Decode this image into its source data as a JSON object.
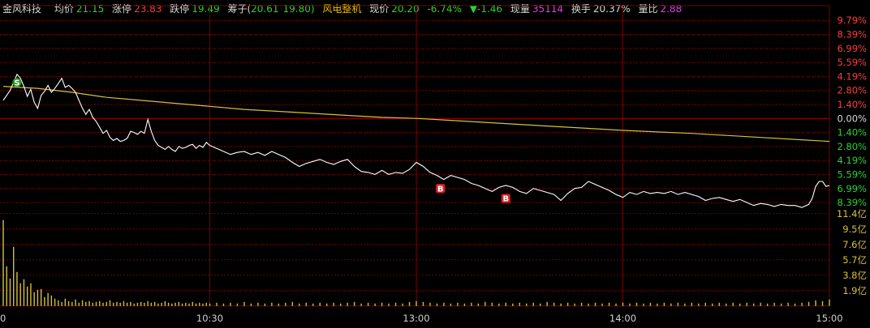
{
  "header": {
    "stock_name": "金风科技",
    "avg_label": "均价",
    "avg_value": "21.15",
    "limit_up_label": "涨停",
    "limit_up_value": "23.83",
    "limit_down_label": "跌停",
    "limit_down_value": "19.49",
    "chips_label": "筹子(",
    "chips_value_1": "20.61",
    "chips_value_2": "19.80)",
    "sector": "风电整机",
    "price_label": "现价",
    "price_value": "20.20",
    "change_pct": "-6.74%",
    "change_value": "▼-1.46",
    "volume_label": "现量",
    "volume_value": "35114",
    "turnover_label": "换手",
    "turnover_value": "20.37%",
    "vol_ratio_label": "量比",
    "vol_ratio_value": "2.88"
  },
  "colors": {
    "background": "#000000",
    "grid": "#7a0000",
    "price_line": "#ffffff",
    "avg_line": "#d4c23a",
    "volume_bars": "#d4c23a",
    "up": "#ff3b3b",
    "down": "#2ad52a",
    "neutral": "#d8d8d8",
    "marker_buy": "#e02020",
    "marker_sell": "#1aa01a"
  },
  "chart_data": {
    "type": "line",
    "y_right_labels": [
      {
        "text": "9.79%",
        "tone": "up"
      },
      {
        "text": "8.39%",
        "tone": "up"
      },
      {
        "text": "6.99%",
        "tone": "up"
      },
      {
        "text": "5.59%",
        "tone": "up"
      },
      {
        "text": "4.19%",
        "tone": "up"
      },
      {
        "text": "2.80%",
        "tone": "up"
      },
      {
        "text": "1.40%",
        "tone": "up"
      },
      {
        "text": "0.00%",
        "tone": "neutral"
      },
      {
        "text": "1.40%",
        "tone": "down"
      },
      {
        "text": "2.80%",
        "tone": "down"
      },
      {
        "text": "4.19%",
        "tone": "down"
      },
      {
        "text": "5.59%",
        "tone": "down"
      },
      {
        "text": "6.99%",
        "tone": "down"
      },
      {
        "text": "8.39%",
        "tone": "down"
      }
    ],
    "y_pct_ticks": [
      9.79,
      8.39,
      6.99,
      5.59,
      4.19,
      2.8,
      1.4,
      0.0,
      -1.4,
      -2.8,
      -4.19,
      -5.59,
      -6.99,
      -8.39
    ],
    "volume_labels": [
      "11.4亿",
      "9.5亿",
      "7.6亿",
      "5.7亿",
      "3.8亿",
      "1.9亿"
    ],
    "volume_ticks": [
      11.4,
      9.5,
      7.6,
      5.7,
      3.8,
      1.9
    ],
    "x_labels": [
      {
        "text": "0",
        "minute": 0
      },
      {
        "text": "10:30",
        "minute": 60
      },
      {
        "text": "13:00",
        "minute": 120
      },
      {
        "text": "14:00",
        "minute": 180
      },
      {
        "text": "15:00",
        "minute": 240
      }
    ],
    "price_pct": [
      [
        0,
        1.8
      ],
      [
        2,
        2.8
      ],
      [
        4,
        4.4
      ],
      [
        5,
        4.0
      ],
      [
        6,
        3.2
      ],
      [
        7,
        2.2
      ],
      [
        8,
        2.9
      ],
      [
        9,
        1.6
      ],
      [
        10,
        1.0
      ],
      [
        11,
        2.3
      ],
      [
        12,
        2.7
      ],
      [
        13,
        3.3
      ],
      [
        14,
        2.6
      ],
      [
        15,
        3.0
      ],
      [
        16,
        3.5
      ],
      [
        17,
        4.0
      ],
      [
        18,
        3.1
      ],
      [
        19,
        3.3
      ],
      [
        20,
        3.0
      ],
      [
        21,
        2.6
      ],
      [
        22,
        1.8
      ],
      [
        23,
        1.0
      ],
      [
        24,
        0.4
      ],
      [
        25,
        0.9
      ],
      [
        26,
        0.1
      ],
      [
        27,
        -0.3
      ],
      [
        28,
        -0.9
      ],
      [
        29,
        -1.5
      ],
      [
        30,
        -1.2
      ],
      [
        31,
        -1.9
      ],
      [
        32,
        -2.2
      ],
      [
        33,
        -2.0
      ],
      [
        34,
        -2.3
      ],
      [
        35,
        -2.2
      ],
      [
        36,
        -2.0
      ],
      [
        37,
        -1.3
      ],
      [
        38,
        -1.4
      ],
      [
        39,
        -1.6
      ],
      [
        40,
        -1.3
      ],
      [
        41,
        -1.5
      ],
      [
        42,
        -0.1
      ],
      [
        43,
        -1.3
      ],
      [
        44,
        -2.2
      ],
      [
        45,
        -2.7
      ],
      [
        46,
        -2.9
      ],
      [
        47,
        -3.1
      ],
      [
        48,
        -2.8
      ],
      [
        49,
        -3.1
      ],
      [
        50,
        -3.3
      ],
      [
        51,
        -2.8
      ],
      [
        52,
        -3.0
      ],
      [
        53,
        -2.9
      ],
      [
        54,
        -2.7
      ],
      [
        55,
        -2.6
      ],
      [
        56,
        -3.0
      ],
      [
        57,
        -2.7
      ],
      [
        58,
        -2.9
      ],
      [
        59,
        -2.4
      ],
      [
        60,
        -2.7
      ],
      [
        62,
        -3.0
      ],
      [
        64,
        -3.3
      ],
      [
        66,
        -3.6
      ],
      [
        68,
        -3.4
      ],
      [
        70,
        -3.3
      ],
      [
        72,
        -3.6
      ],
      [
        74,
        -3.4
      ],
      [
        76,
        -3.7
      ],
      [
        78,
        -3.3
      ],
      [
        80,
        -3.6
      ],
      [
        82,
        -3.9
      ],
      [
        84,
        -4.4
      ],
      [
        86,
        -4.8
      ],
      [
        88,
        -4.5
      ],
      [
        90,
        -4.3
      ],
      [
        92,
        -4.1
      ],
      [
        94,
        -4.4
      ],
      [
        96,
        -4.6
      ],
      [
        98,
        -4.3
      ],
      [
        100,
        -4.1
      ],
      [
        102,
        -4.8
      ],
      [
        104,
        -5.3
      ],
      [
        106,
        -5.4
      ],
      [
        108,
        -5.6
      ],
      [
        110,
        -5.2
      ],
      [
        112,
        -5.6
      ],
      [
        114,
        -5.4
      ],
      [
        116,
        -5.5
      ],
      [
        118,
        -5.1
      ],
      [
        120,
        -4.4
      ],
      [
        122,
        -4.8
      ],
      [
        124,
        -5.4
      ],
      [
        126,
        -5.7
      ],
      [
        128,
        -6.1
      ],
      [
        130,
        -5.7
      ],
      [
        132,
        -5.9
      ],
      [
        134,
        -6.1
      ],
      [
        136,
        -6.5
      ],
      [
        138,
        -6.7
      ],
      [
        140,
        -7.0
      ],
      [
        142,
        -7.3
      ],
      [
        144,
        -6.9
      ],
      [
        146,
        -6.7
      ],
      [
        148,
        -6.9
      ],
      [
        150,
        -7.3
      ],
      [
        152,
        -7.5
      ],
      [
        154,
        -7.0
      ],
      [
        156,
        -7.2
      ],
      [
        158,
        -7.4
      ],
      [
        160,
        -7.6
      ],
      [
        162,
        -8.2
      ],
      [
        164,
        -7.5
      ],
      [
        166,
        -7.0
      ],
      [
        168,
        -6.9
      ],
      [
        170,
        -6.3
      ],
      [
        172,
        -6.6
      ],
      [
        174,
        -6.9
      ],
      [
        176,
        -7.2
      ],
      [
        178,
        -7.6
      ],
      [
        180,
        -7.9
      ],
      [
        182,
        -7.4
      ],
      [
        184,
        -7.6
      ],
      [
        186,
        -7.3
      ],
      [
        188,
        -7.5
      ],
      [
        190,
        -7.4
      ],
      [
        192,
        -7.5
      ],
      [
        194,
        -7.3
      ],
      [
        196,
        -7.6
      ],
      [
        198,
        -7.4
      ],
      [
        200,
        -7.6
      ],
      [
        202,
        -7.8
      ],
      [
        204,
        -8.2
      ],
      [
        206,
        -8.0
      ],
      [
        208,
        -7.9
      ],
      [
        210,
        -8.1
      ],
      [
        212,
        -8.3
      ],
      [
        214,
        -8.1
      ],
      [
        216,
        -8.4
      ],
      [
        218,
        -8.7
      ],
      [
        220,
        -8.5
      ],
      [
        222,
        -8.6
      ],
      [
        224,
        -8.8
      ],
      [
        226,
        -8.6
      ],
      [
        228,
        -8.7
      ],
      [
        230,
        -8.7
      ],
      [
        232,
        -8.9
      ],
      [
        234,
        -8.6
      ],
      [
        235,
        -8.0
      ],
      [
        236,
        -6.8
      ],
      [
        237,
        -6.3
      ],
      [
        238,
        -6.3
      ],
      [
        239,
        -6.8
      ],
      [
        240,
        -6.7
      ]
    ],
    "avg_pct": [
      [
        0,
        3.2
      ],
      [
        10,
        3.0
      ],
      [
        20,
        2.6
      ],
      [
        30,
        2.1
      ],
      [
        40,
        1.8
      ],
      [
        50,
        1.5
      ],
      [
        60,
        1.2
      ],
      [
        70,
        0.9
      ],
      [
        80,
        0.7
      ],
      [
        90,
        0.5
      ],
      [
        100,
        0.3
      ],
      [
        110,
        0.1
      ],
      [
        120,
        0.0
      ],
      [
        130,
        -0.2
      ],
      [
        140,
        -0.4
      ],
      [
        150,
        -0.6
      ],
      [
        160,
        -0.8
      ],
      [
        170,
        -1.0
      ],
      [
        180,
        -1.2
      ],
      [
        190,
        -1.35
      ],
      [
        200,
        -1.5
      ],
      [
        210,
        -1.7
      ],
      [
        220,
        -1.9
      ],
      [
        230,
        -2.1
      ],
      [
        240,
        -2.3
      ]
    ],
    "volume_yi": [
      [
        0,
        10.6
      ],
      [
        1,
        4.9
      ],
      [
        2,
        3.4
      ],
      [
        3,
        7.3
      ],
      [
        4,
        4.2
      ],
      [
        5,
        2.8
      ],
      [
        6,
        3.3
      ],
      [
        7,
        2.4
      ],
      [
        8,
        2.8
      ],
      [
        9,
        1.7
      ],
      [
        10,
        2.0
      ],
      [
        11,
        2.1
      ],
      [
        12,
        1.1
      ],
      [
        13,
        1.6
      ],
      [
        14,
        1.3
      ],
      [
        15,
        0.9
      ],
      [
        16,
        0.7
      ],
      [
        17,
        0.5
      ],
      [
        18,
        0.9
      ],
      [
        19,
        0.6
      ],
      [
        20,
        0.5
      ],
      [
        21,
        0.8
      ],
      [
        22,
        0.4
      ],
      [
        23,
        0.7
      ],
      [
        24,
        0.5
      ],
      [
        25,
        0.6
      ],
      [
        26,
        0.4
      ],
      [
        27,
        0.5
      ],
      [
        28,
        0.6
      ],
      [
        29,
        0.4
      ],
      [
        30,
        0.5
      ],
      [
        31,
        0.7
      ],
      [
        32,
        0.4
      ],
      [
        33,
        0.5
      ],
      [
        34,
        0.4
      ],
      [
        35,
        0.6
      ],
      [
        36,
        0.4
      ],
      [
        37,
        0.5
      ],
      [
        38,
        0.3
      ],
      [
        39,
        0.4
      ],
      [
        40,
        0.5
      ],
      [
        41,
        0.4
      ],
      [
        42,
        0.6
      ],
      [
        43,
        0.4
      ],
      [
        44,
        0.5
      ],
      [
        45,
        0.3
      ],
      [
        46,
        0.4
      ],
      [
        47,
        0.6
      ],
      [
        48,
        0.4
      ],
      [
        49,
        0.3
      ],
      [
        50,
        0.4
      ],
      [
        51,
        0.5
      ],
      [
        52,
        0.3
      ],
      [
        53,
        0.4
      ],
      [
        54,
        0.3
      ],
      [
        55,
        0.5
      ],
      [
        56,
        0.3
      ],
      [
        57,
        0.4
      ],
      [
        58,
        0.3
      ],
      [
        59,
        0.4
      ],
      [
        60,
        0.3
      ],
      [
        62,
        0.4
      ],
      [
        64,
        0.3
      ],
      [
        66,
        0.4
      ],
      [
        68,
        0.3
      ],
      [
        70,
        0.5
      ],
      [
        72,
        0.3
      ],
      [
        74,
        0.4
      ],
      [
        76,
        0.3
      ],
      [
        78,
        0.4
      ],
      [
        80,
        0.3
      ],
      [
        82,
        0.4
      ],
      [
        84,
        0.5
      ],
      [
        86,
        0.3
      ],
      [
        88,
        0.4
      ],
      [
        90,
        0.3
      ],
      [
        92,
        0.4
      ],
      [
        94,
        0.3
      ],
      [
        96,
        0.4
      ],
      [
        98,
        0.3
      ],
      [
        100,
        0.4
      ],
      [
        102,
        0.5
      ],
      [
        104,
        0.3
      ],
      [
        106,
        0.4
      ],
      [
        108,
        0.3
      ],
      [
        110,
        0.4
      ],
      [
        112,
        0.3
      ],
      [
        114,
        0.4
      ],
      [
        116,
        0.3
      ],
      [
        118,
        0.5
      ],
      [
        120,
        0.6
      ],
      [
        122,
        0.5
      ],
      [
        124,
        0.4
      ],
      [
        126,
        0.3
      ],
      [
        128,
        0.4
      ],
      [
        130,
        0.3
      ],
      [
        132,
        0.4
      ],
      [
        134,
        0.3
      ],
      [
        136,
        0.4
      ],
      [
        138,
        0.3
      ],
      [
        140,
        0.5
      ],
      [
        142,
        0.4
      ],
      [
        144,
        0.3
      ],
      [
        146,
        0.4
      ],
      [
        148,
        0.3
      ],
      [
        150,
        0.4
      ],
      [
        152,
        0.3
      ],
      [
        154,
        0.4
      ],
      [
        156,
        0.3
      ],
      [
        158,
        0.5
      ],
      [
        160,
        0.4
      ],
      [
        162,
        0.3
      ],
      [
        164,
        0.4
      ],
      [
        166,
        0.3
      ],
      [
        168,
        0.4
      ],
      [
        170,
        0.3
      ],
      [
        172,
        0.4
      ],
      [
        174,
        0.3
      ],
      [
        176,
        0.4
      ],
      [
        178,
        0.3
      ],
      [
        180,
        0.4
      ],
      [
        182,
        0.3
      ],
      [
        184,
        0.4
      ],
      [
        186,
        0.3
      ],
      [
        188,
        0.4
      ],
      [
        190,
        0.3
      ],
      [
        192,
        0.4
      ],
      [
        194,
        0.3
      ],
      [
        196,
        0.4
      ],
      [
        198,
        0.3
      ],
      [
        200,
        0.4
      ],
      [
        202,
        0.3
      ],
      [
        204,
        0.4
      ],
      [
        206,
        0.3
      ],
      [
        208,
        0.4
      ],
      [
        210,
        0.3
      ],
      [
        212,
        0.4
      ],
      [
        214,
        0.3
      ],
      [
        216,
        0.4
      ],
      [
        218,
        0.3
      ],
      [
        220,
        0.4
      ],
      [
        222,
        0.3
      ],
      [
        224,
        0.4
      ],
      [
        226,
        0.3
      ],
      [
        228,
        0.4
      ],
      [
        230,
        0.3
      ],
      [
        232,
        0.4
      ],
      [
        234,
        0.5
      ],
      [
        236,
        0.7
      ],
      [
        238,
        0.6
      ],
      [
        240,
        0.8
      ]
    ],
    "markers": [
      {
        "label": "S",
        "type": "sell",
        "minute": 4,
        "pct": 3.6
      },
      {
        "label": "B",
        "type": "buy",
        "minute": 127,
        "pct": -7.0
      },
      {
        "label": "B",
        "type": "buy",
        "minute": 146,
        "pct": -8.0
      }
    ]
  }
}
